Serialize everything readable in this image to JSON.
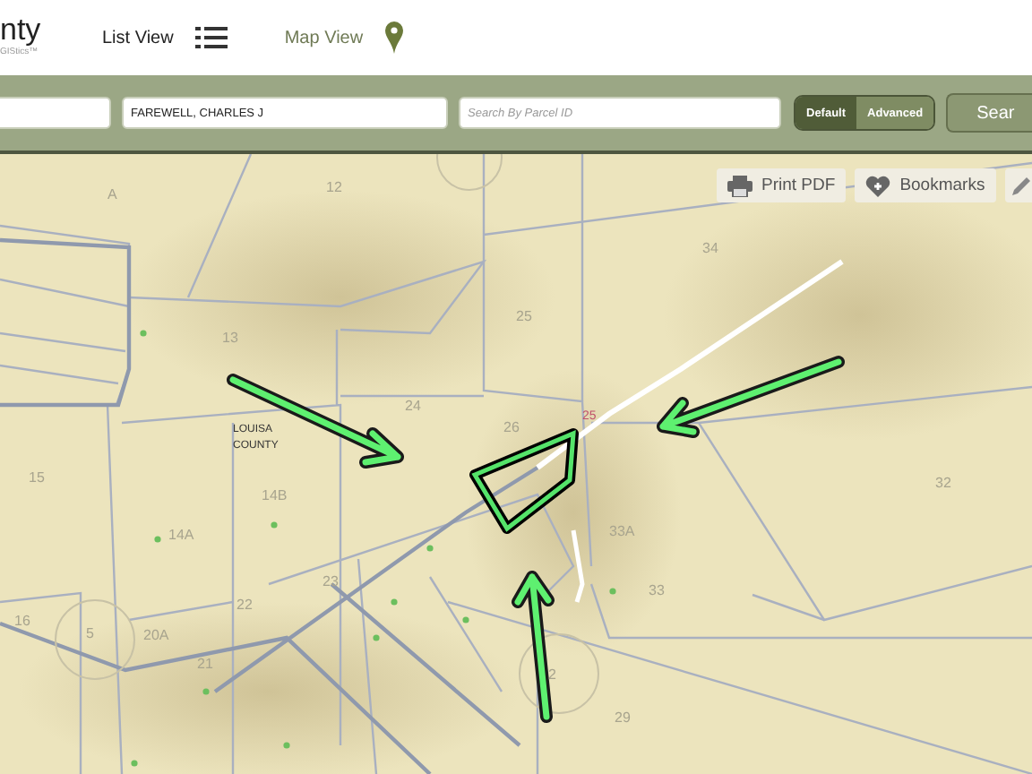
{
  "header": {
    "logo_text": "nty",
    "logo_subtitle": "GIStics™",
    "nav": [
      {
        "label": "List View",
        "selected": false
      },
      {
        "label": "Map View",
        "selected": true
      }
    ]
  },
  "search_bar": {
    "fields": [
      {
        "value": "FAREWELL, CHARLES J"
      },
      {
        "placeholder": "Search By Parcel ID"
      }
    ],
    "mode_toggle": [
      {
        "label": "Default",
        "selected": true
      },
      {
        "label": "Advanced",
        "selected": false
      }
    ],
    "search_button": "Sear"
  },
  "map": {
    "toolbar": [
      {
        "label": "Print PDF"
      },
      {
        "label": "Bookmarks"
      }
    ],
    "parcel_labels": [
      {
        "text": "A",
        "kind": "parcel"
      },
      {
        "text": "12",
        "kind": "parcel"
      },
      {
        "text": "34",
        "kind": "parcel"
      },
      {
        "text": "13",
        "kind": "parcel"
      },
      {
        "text": "25",
        "kind": "parcel"
      },
      {
        "text": "24",
        "kind": "parcel"
      },
      {
        "text": "26",
        "kind": "parcel"
      },
      {
        "text": "25",
        "kind": "route"
      },
      {
        "text": "LOUISA COUNTY",
        "kind": "place"
      },
      {
        "text": "32",
        "kind": "parcel"
      },
      {
        "text": "14B",
        "kind": "parcel"
      },
      {
        "text": "33A",
        "kind": "parcel"
      },
      {
        "text": "14A",
        "kind": "parcel"
      },
      {
        "text": "33",
        "kind": "parcel"
      },
      {
        "text": "15",
        "kind": "parcel"
      },
      {
        "text": "23",
        "kind": "parcel"
      },
      {
        "text": "16",
        "kind": "parcel"
      },
      {
        "text": "5",
        "kind": "parcel"
      },
      {
        "text": "20A",
        "kind": "parcel"
      },
      {
        "text": "22",
        "kind": "parcel"
      },
      {
        "text": "21",
        "kind": "parcel"
      },
      {
        "text": "29",
        "kind": "parcel"
      },
      {
        "text": "2",
        "kind": "parcel"
      }
    ]
  }
}
